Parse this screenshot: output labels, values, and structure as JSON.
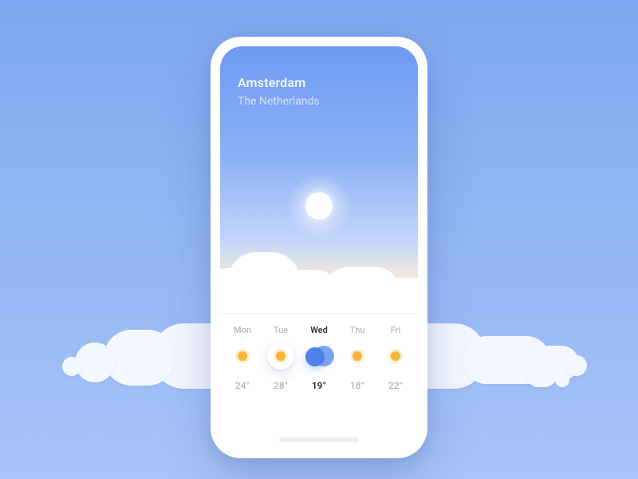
{
  "location": {
    "city": "Amsterdam",
    "country": "The Netherlands"
  },
  "forecast": {
    "selected_index": 2,
    "days": [
      {
        "label": "Mon",
        "condition": "sunny",
        "temp": "24°"
      },
      {
        "label": "Tue",
        "condition": "sunny",
        "temp": "28°"
      },
      {
        "label": "Wed",
        "condition": "cloudy",
        "temp": "19°"
      },
      {
        "label": "Thu",
        "condition": "sunny",
        "temp": "18°"
      },
      {
        "label": "Fri",
        "condition": "sunny",
        "temp": "22°"
      }
    ]
  },
  "colors": {
    "sky_top": "#6e9af3",
    "sky_bottom": "#ffffff",
    "accent_sun": "#f5b63a",
    "accent_cloud": "#4f82e8"
  }
}
